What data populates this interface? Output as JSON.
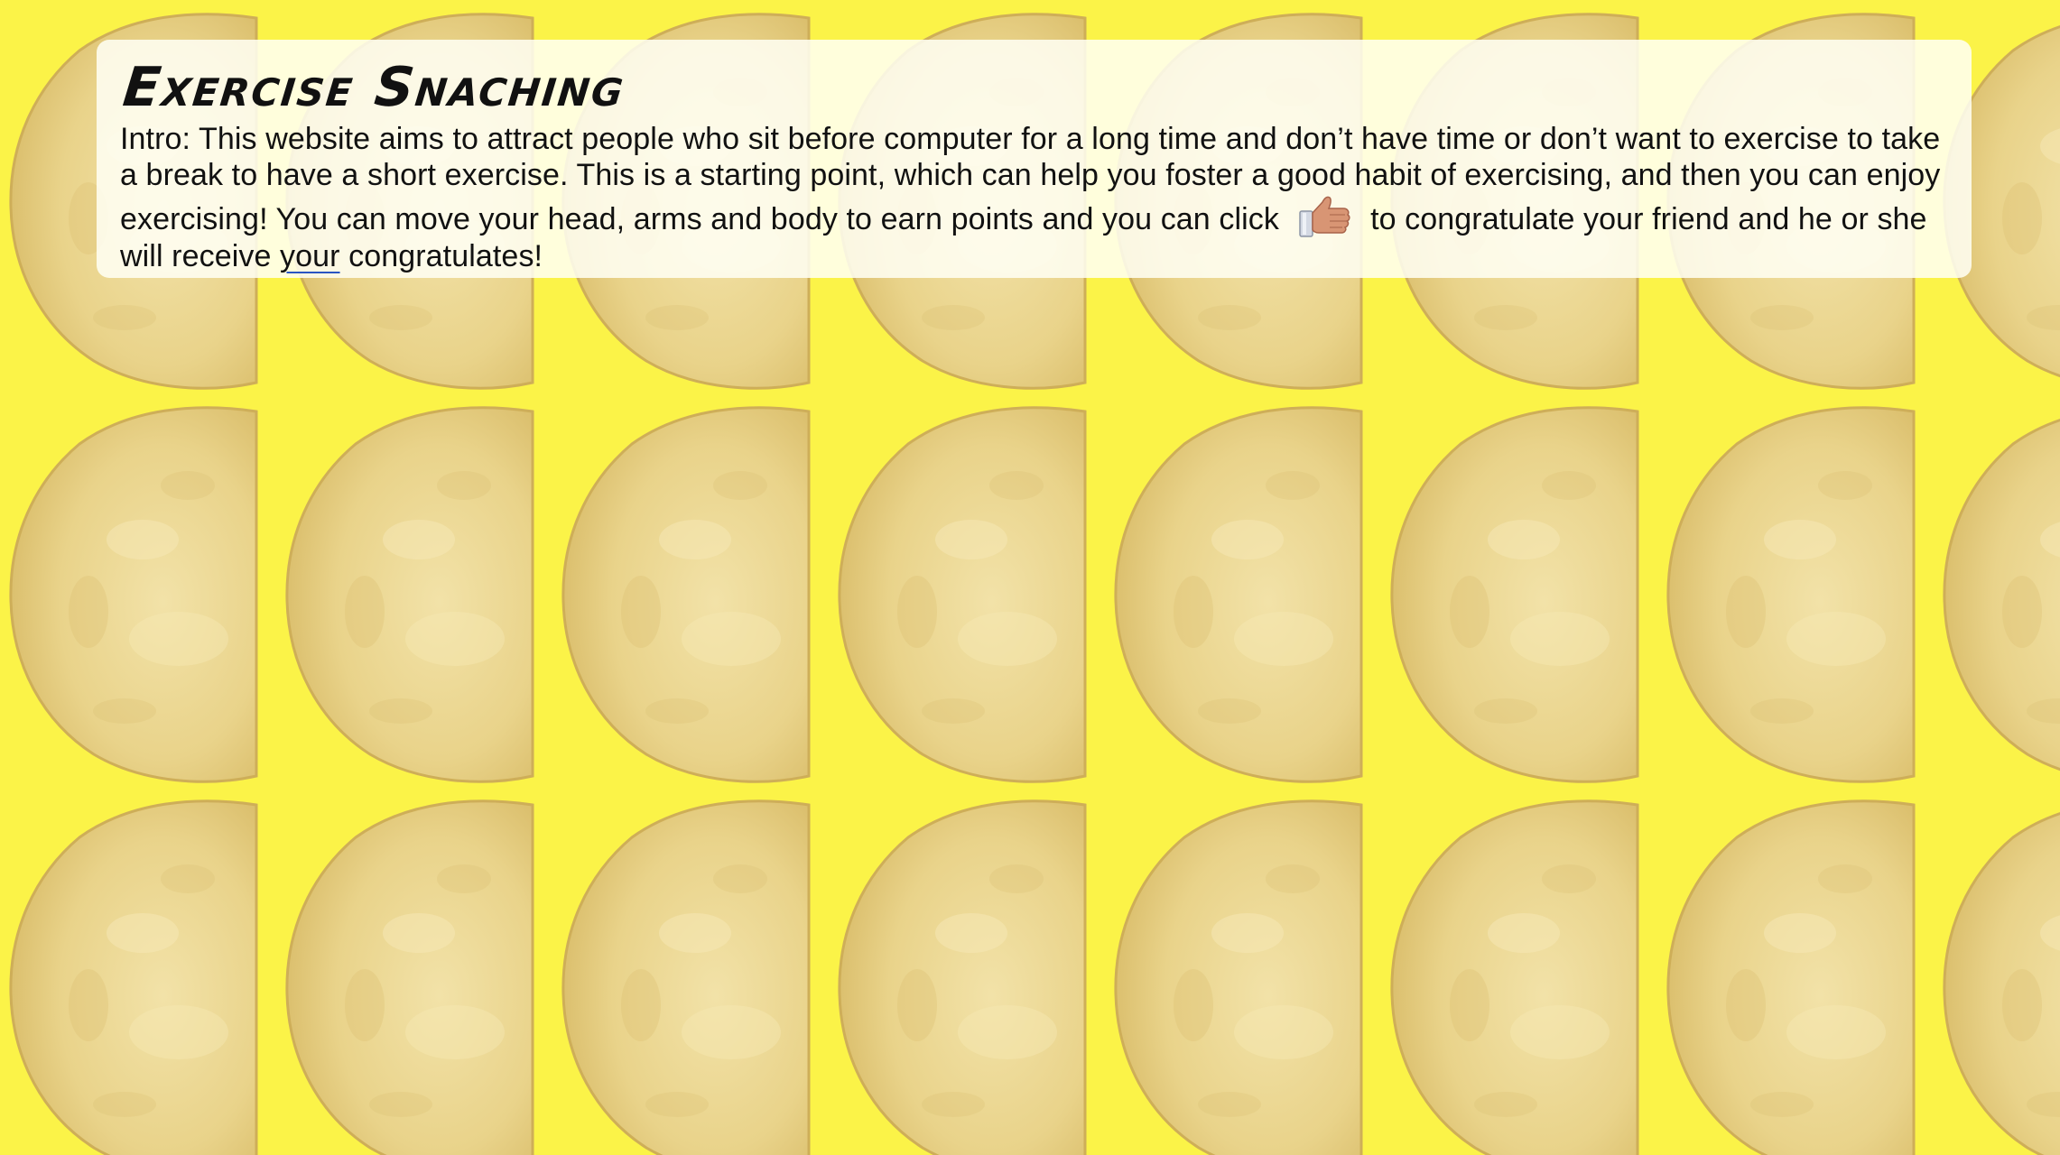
{
  "page": {
    "title": "Exercise Snaching",
    "background_color": "#fbf348",
    "chip_color": "#e9d38a"
  },
  "intro": {
    "part1": "Intro: This website aims to attract people who sit before computer for a long time and don’t have time or don’t want to exercise to take a break to have a short exercise. This is a starting point, which can help you foster a good habit of exercising, and then you can enjoy exercising! You can move your head, arms and body to earn points and you can click",
    "part2": "to congratulate your friend and he or she will receive",
    "underlined_word": "your",
    "part3": "congratulates!",
    "button_icon": "thumbs-up-icon"
  }
}
